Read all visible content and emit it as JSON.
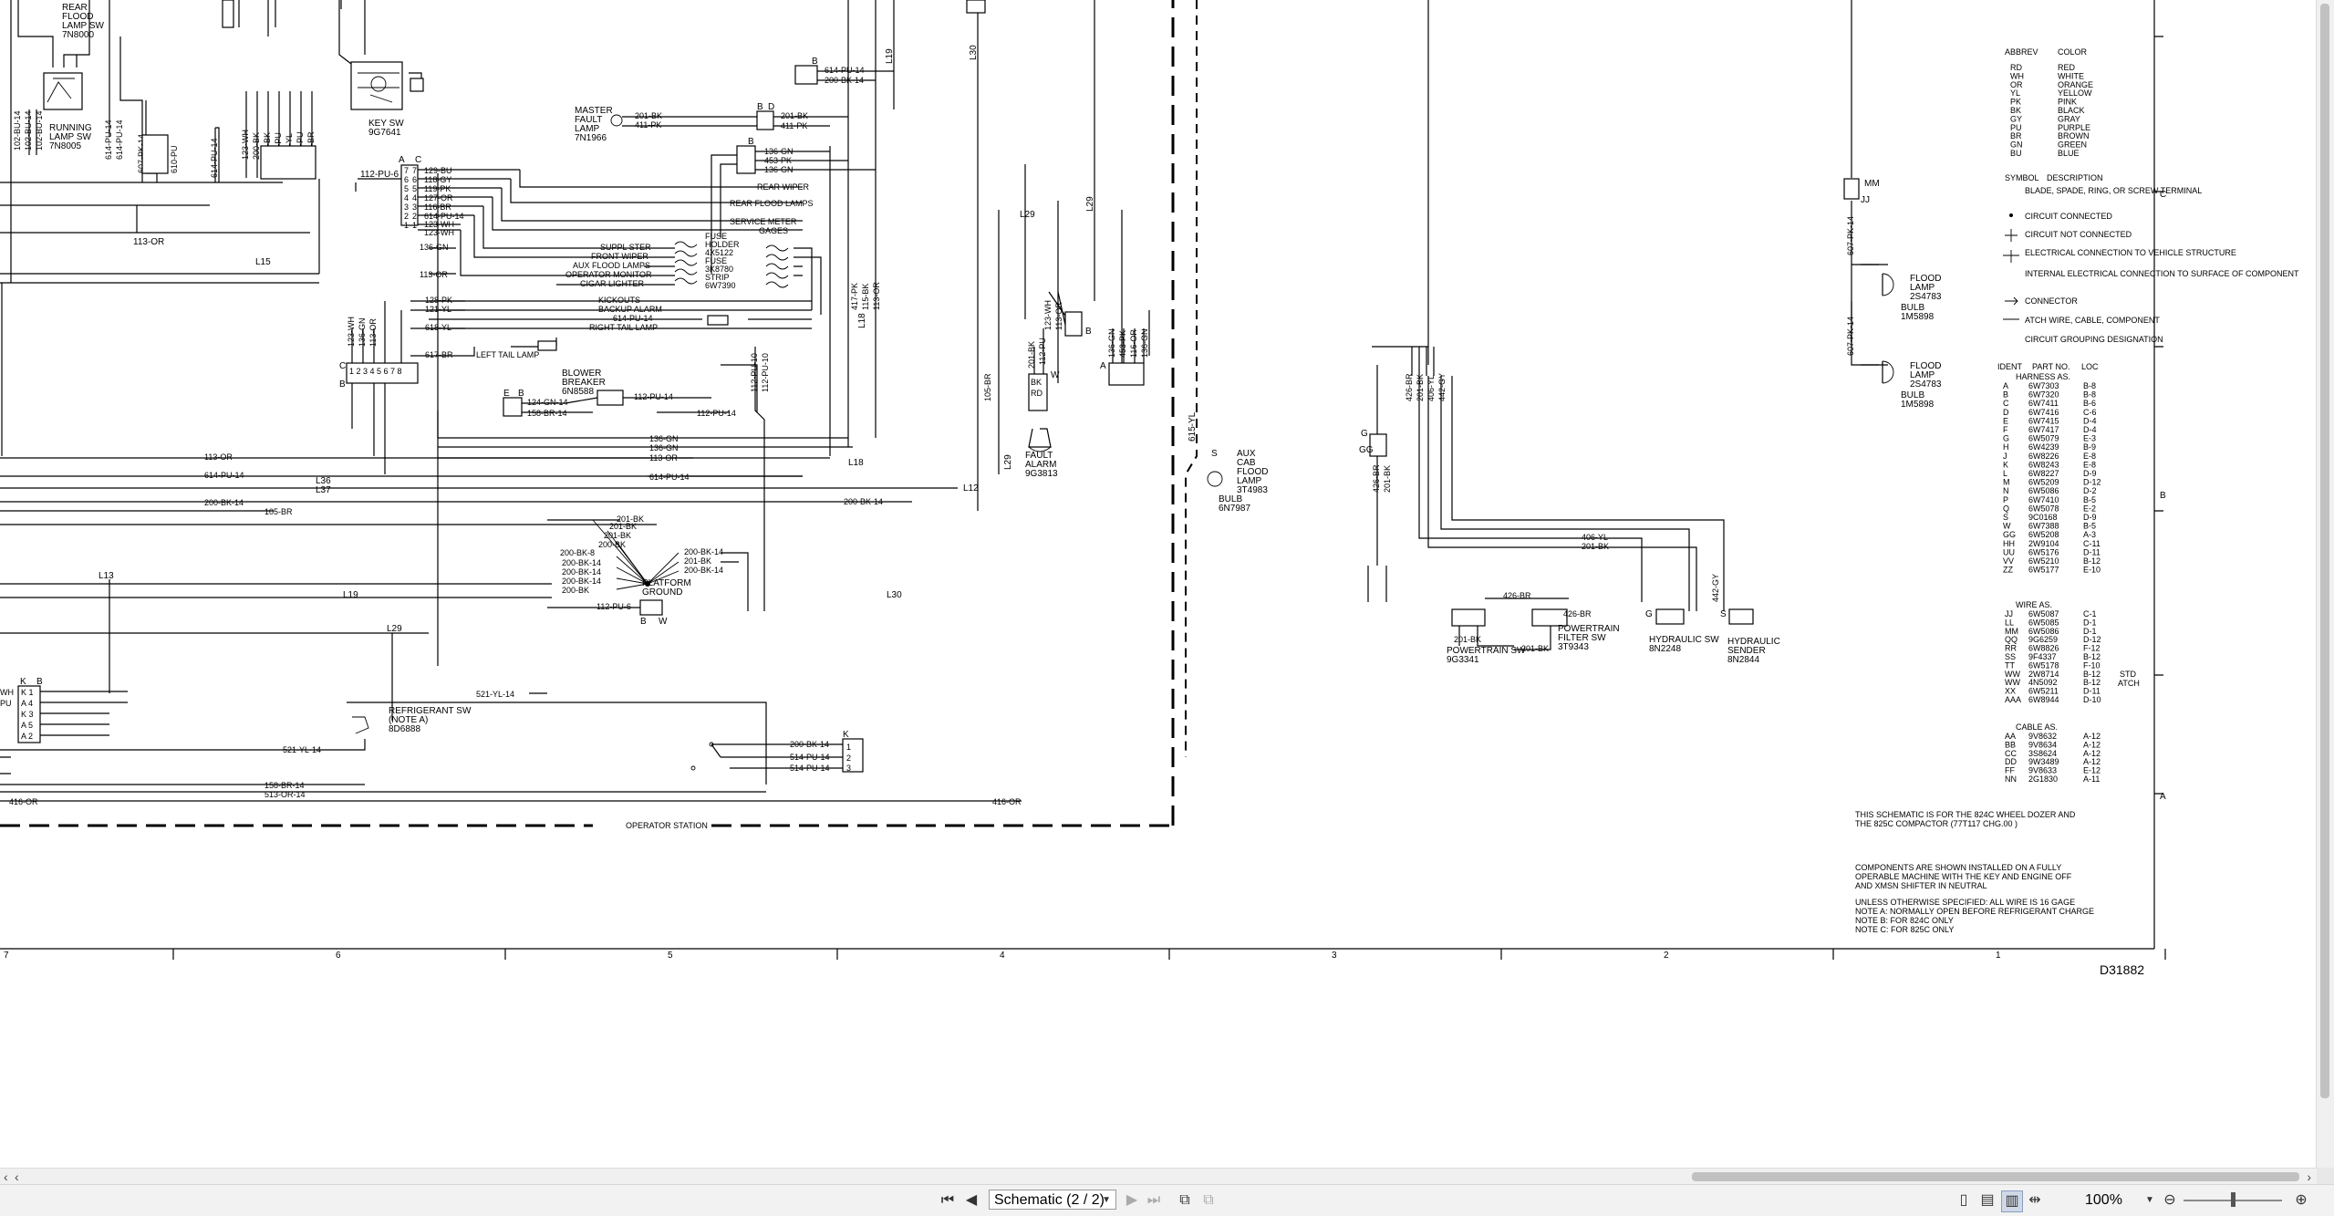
{
  "toolbar": {
    "page_label": "Schematic (2 / 2)",
    "zoom_label": "100%",
    "icons": [
      "first-page-icon",
      "prev-page-icon",
      "next-page-icon",
      "last-page-icon",
      "two-page-view-icon",
      "compare-icon",
      "single-page-icon",
      "continuous-page-icon",
      "facing-pages-icon",
      "fit-width-icon",
      "zoom-out-icon",
      "zoom-in-icon"
    ]
  },
  "drawing": {
    "drawing_number": "D31882",
    "column_numbers": [
      "7",
      "6",
      "5",
      "4",
      "3",
      "2",
      "1"
    ],
    "row_letters": [
      "C",
      "B",
      "A"
    ],
    "operator_station": "OPERATOR STATION",
    "labels": {
      "rear_flood_lamp_sw": [
        "REAR",
        "FLOOD",
        "LAMP SW",
        "7N8000"
      ],
      "running_lamp_sw": [
        "RUNNING",
        "LAMP SW",
        "7N8005"
      ],
      "key_sw": [
        "KEY SW",
        "9G7641"
      ],
      "master_fault_lamp": [
        "MASTER",
        "FAULT",
        "LAMP",
        "7N1966"
      ],
      "fuse_holder": [
        "FUSE",
        "HOLDER",
        "4X5122",
        "FUSE",
        "3K8780",
        "STRIP",
        "6W7390"
      ],
      "blower_breaker": [
        "BLOWER",
        "BREAKER",
        "6N8588"
      ],
      "fault_alarm": [
        "FAULT",
        "ALARM",
        "9G3813"
      ],
      "platform_ground": [
        "PLATFORM",
        "GROUND"
      ],
      "refrigerant_sw": [
        "REFRIGERANT SW",
        "(NOTE A)",
        "8D6888"
      ],
      "aux_cab_flood_lamp": [
        "AUX",
        "CAB",
        "FLOOD",
        "LAMP",
        "3T4983"
      ],
      "bulb_left": [
        "BULB",
        "6N7987"
      ],
      "powertrain_sw": [
        "POWERTRAIN SW",
        "9G3341"
      ],
      "powertrain_filter_sw": [
        "POWERTRAIN",
        "FILTER SW",
        "3T9343"
      ],
      "hydraulic_sw": [
        "HYDRAULIC SW",
        "8N2248"
      ],
      "hydraulic_sender": [
        "HYDRAULIC",
        "SENDER",
        "8N2844"
      ],
      "flood_lamp_1": [
        "FLOOD",
        "LAMP",
        "2S4783",
        "BULB",
        "1M5898"
      ],
      "flood_lamp_2": [
        "FLOOD",
        "LAMP",
        "2S4783",
        "BULB",
        "1M5898"
      ]
    },
    "circuits": {
      "center_rows": [
        "129-BU",
        "118-GY",
        "119-PK",
        "127-OR",
        "116-BR",
        "614-PU-14",
        "123-WH",
        "123-WH"
      ],
      "right_circuits": [
        "REAR WIPER",
        "REAR FLOOD LAMPS",
        "SERVICE METER",
        "GAGES"
      ],
      "fuse_circuits": [
        "SUPPL STER",
        "FRONT WIPER",
        "AUX FLOOD LAMPS",
        "OPERATOR MONITOR",
        "CIGAR LIGHTER"
      ],
      "lower_circuits": [
        "KICKOUTS",
        "BACKUP ALARM",
        "614-PU-14",
        "RIGHT TAIL LAMP"
      ],
      "left_tail": [
        "128-PK",
        "121-YL",
        "618-YL",
        "617-BR",
        "LEFT TAIL LAMP"
      ],
      "fault_lamp_wires": [
        "201-BK",
        "411-PK",
        "201-BK",
        "411-PK"
      ],
      "gauge_wires": [
        "136-GN",
        "453-PK",
        "136-GN"
      ],
      "bus_wires": [
        "113-OR",
        "614-PU-14",
        "200-BK-14",
        "105-BR",
        "136-GN",
        "136-GN",
        "113-OR",
        "614-PU-14",
        "200-BK-14"
      ],
      "ground_wires": [
        "201-BK",
        "201-BK",
        "201-BK",
        "200-BK",
        "200-BK-8",
        "200-BK-14",
        "200-BK-14",
        "200-BK-14",
        "200-BK",
        "200-BK-14",
        "201-BK",
        "200-BK-14"
      ],
      "blower_wires": [
        "124-GN-14",
        "158-BR-14",
        "112-PU-14",
        "112-PU-14"
      ],
      "refrigerant_wires": [
        "521-YL-14",
        "521-YL-14",
        "158-BR-14",
        "513-OR-14",
        "200-BK-14",
        "514-PU-14",
        "514-PU-14",
        "416-OR",
        "416-OR"
      ],
      "misc": [
        "112-PU-6",
        "113-OR",
        "L15",
        "L36",
        "L37",
        "L29",
        "L30",
        "L18",
        "L12",
        "L19",
        "L13",
        "L19",
        "L29",
        "L30",
        "L29",
        "L18"
      ],
      "right_side": [
        "406-YL",
        "201-BK",
        "426-BR",
        "426-BR",
        "201-BK",
        "201-BK",
        "442-GY",
        "615-YL",
        "607-PK-14",
        "607-PK-14"
      ]
    },
    "legend": {
      "abbrev_header": "ABBREV",
      "color_header": "COLOR",
      "colors": [
        [
          "RD",
          "RED"
        ],
        [
          "WH",
          "WHITE"
        ],
        [
          "OR",
          "ORANGE"
        ],
        [
          "YL",
          "YELLOW"
        ],
        [
          "PK",
          "PINK"
        ],
        [
          "BK",
          "BLACK"
        ],
        [
          "GY",
          "GRAY"
        ],
        [
          "PU",
          "PURPLE"
        ],
        [
          "BR",
          "BROWN"
        ],
        [
          "GN",
          "GREEN"
        ],
        [
          "BU",
          "BLUE"
        ]
      ],
      "symbol_header": "SYMBOL",
      "description_header": "DESCRIPTION",
      "symbols": [
        "BLADE, SPADE, RING, OR SCREW TERMINAL",
        "CIRCUIT CONNECTED",
        "CIRCUIT NOT CONNECTED",
        "ELECTRICAL CONNECTION TO VEHICLE STRUCTURE",
        "INTERNAL ELECTRICAL CONNECTION TO SURFACE OF COMPONENT",
        "CONNECTOR",
        "ATCH WIRE, CABLE, COMPONENT",
        "CIRCUIT GROUPING DESIGNATION"
      ],
      "ident_header": "IDENT",
      "partno_header": "PART NO.",
      "loc_header": "LOC",
      "harness_header": "HARNESS AS.",
      "harness": [
        [
          "A",
          "6W7303",
          "B-8"
        ],
        [
          "B",
          "6W7320",
          "B-8"
        ],
        [
          "C",
          "6W7411",
          "B-6"
        ],
        [
          "D",
          "6W7416",
          "C-6"
        ],
        [
          "E",
          "6W7415",
          "D-4"
        ],
        [
          "F",
          "6W7417",
          "D-4"
        ],
        [
          "G",
          "6W5079",
          "E-3"
        ],
        [
          "H",
          "6W4239",
          "B-9"
        ],
        [
          "J",
          "6W8226",
          "E-8"
        ],
        [
          "K",
          "6W8243",
          "E-8"
        ],
        [
          "L",
          "6W8227",
          "D-9"
        ],
        [
          "M",
          "6W5209",
          "D-12"
        ],
        [
          "N",
          "6W5086",
          "D-2"
        ],
        [
          "P",
          "6W7410",
          "B-5"
        ],
        [
          "Q",
          "6W5078",
          "E-2"
        ],
        [
          "S",
          "9C0168",
          "D-9"
        ],
        [
          "W",
          "6W7388",
          "B-5"
        ],
        [
          "GG",
          "6W5208",
          "A-3"
        ],
        [
          "HH",
          "2W9104",
          "C-11"
        ],
        [
          "UU",
          "6W5176",
          "D-11"
        ],
        [
          "VV",
          "6W5210",
          "B-12"
        ],
        [
          "ZZ",
          "6W5177",
          "E-10"
        ]
      ],
      "wire_header": "WIRE AS.",
      "wires": [
        [
          "JJ",
          "6W5087",
          "C-1"
        ],
        [
          "LL",
          "6W5085",
          "D-1"
        ],
        [
          "MM",
          "6W5086",
          "D-1"
        ],
        [
          "QQ",
          "9G6259",
          "D-12"
        ],
        [
          "RR",
          "6W8826",
          "F-12"
        ],
        [
          "SS",
          "9F4337",
          "B-12"
        ],
        [
          "TT",
          "6W5178",
          "F-10"
        ],
        [
          "WW",
          "2W8714",
          "B-12"
        ],
        [
          "WW",
          "4N5092",
          "B-12"
        ],
        [
          "XX",
          "6W5211",
          "D-11"
        ],
        [
          "AAA",
          "6W8944",
          "D-10"
        ]
      ],
      "std_atch": [
        "STD",
        "ATCH"
      ],
      "cable_header": "CABLE AS.",
      "cables": [
        [
          "AA",
          "9V8632",
          "A-12"
        ],
        [
          "BB",
          "9V8634",
          "A-12"
        ],
        [
          "CC",
          "3S8624",
          "A-12"
        ],
        [
          "DD",
          "9W3489",
          "A-12"
        ],
        [
          "FF",
          "9V8633",
          "E-12"
        ],
        [
          "NN",
          "2G1830",
          "A-11"
        ]
      ]
    },
    "notes": [
      "THIS SCHEMATIC IS FOR THE 824C WHEEL DOZER AND",
      "THE 825C COMPACTOR (77T117 CHG.00 )",
      "COMPONENTS ARE SHOWN INSTALLED ON A FULLY",
      "OPERABLE MACHINE WITH THE KEY AND ENGINE OFF",
      "AND XMSN SHIFTER IN NEUTRAL",
      "UNLESS OTHERWISE SPECIFIED: ALL WIRE IS 16 GAGE",
      "NOTE A: NORMALLY OPEN BEFORE REFRIGERANT CHARGE",
      "NOTE B: FOR 824C ONLY",
      "NOTE C: FOR 825C ONLY"
    ],
    "connector_letters": [
      "A",
      "C",
      "B",
      "C",
      "K",
      "B",
      "MM",
      "JJ",
      "G",
      "GG",
      "S",
      "K",
      "L",
      "B",
      "D",
      "E",
      "B",
      "P",
      "B",
      "W",
      "G",
      "H",
      "K",
      "A"
    ]
  }
}
